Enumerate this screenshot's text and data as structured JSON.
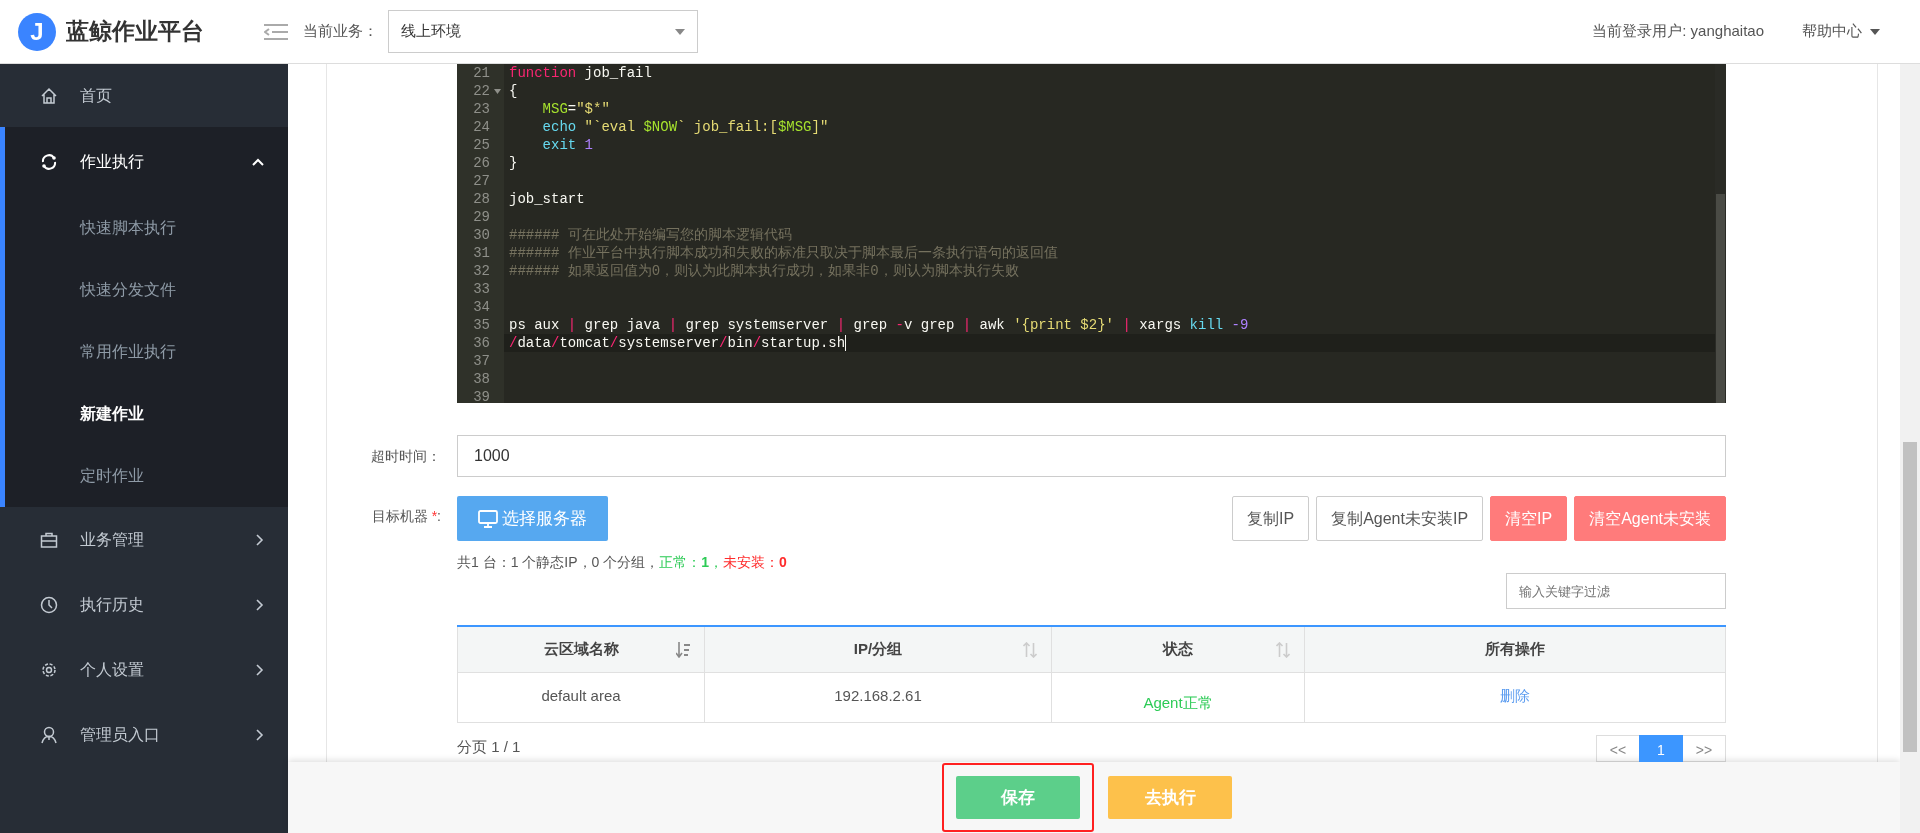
{
  "header": {
    "logo_mark": "J",
    "app_title": "蓝鲸作业平台",
    "business_label": "当前业务：",
    "business_value": "线上环境",
    "user_label": "当前登录用户: yanghaitao",
    "help_menu": "帮助中心"
  },
  "sidebar": {
    "items": [
      {
        "label": "首页",
        "kind": "link",
        "selected": false
      },
      {
        "label": "作业执行",
        "kind": "menu",
        "expanded": true,
        "selected": false,
        "children": [
          {
            "label": "快速脚本执行",
            "selected": false
          },
          {
            "label": "快速分发文件",
            "selected": false
          },
          {
            "label": "常用作业执行",
            "selected": false
          },
          {
            "label": "新建作业",
            "selected": true
          },
          {
            "label": "定时作业",
            "selected": false
          }
        ]
      },
      {
        "label": "业务管理",
        "kind": "menu",
        "expanded": false,
        "selected": false
      },
      {
        "label": "执行历史",
        "kind": "menu",
        "expanded": false,
        "selected": false
      },
      {
        "label": "个人设置",
        "kind": "menu",
        "expanded": false,
        "selected": false
      },
      {
        "label": "管理员入口",
        "kind": "menu",
        "expanded": false,
        "selected": false
      }
    ]
  },
  "editor": {
    "lines": [
      {
        "number": "21",
        "tokens": [
          {
            "kind": "keyword",
            "text": "function"
          },
          {
            "kind": "plain",
            "text": " job_fail"
          }
        ]
      },
      {
        "number": "22",
        "fold": true,
        "tokens": [
          {
            "kind": "plain",
            "text": "{"
          }
        ]
      },
      {
        "number": "23",
        "tokens": [
          {
            "kind": "variable",
            "text": "    MSG"
          },
          {
            "kind": "plain",
            "text": "="
          },
          {
            "kind": "string",
            "text": "\"$*\""
          }
        ]
      },
      {
        "number": "24",
        "tokens": [
          {
            "kind": "builtin",
            "text": "    echo"
          },
          {
            "kind": "string",
            "text": " \"`eval "
          },
          {
            "kind": "variable",
            "text": "$NOW"
          },
          {
            "kind": "string",
            "text": "` job_fail:["
          },
          {
            "kind": "variable",
            "text": "$MSG"
          },
          {
            "kind": "string",
            "text": "]\""
          }
        ]
      },
      {
        "number": "25",
        "tokens": [
          {
            "kind": "builtin",
            "text": "    exit"
          },
          {
            "kind": "number",
            "text": " 1"
          }
        ]
      },
      {
        "number": "26",
        "tokens": [
          {
            "kind": "plain",
            "text": "}"
          }
        ]
      },
      {
        "number": "27"
      },
      {
        "number": "28",
        "tokens": [
          {
            "kind": "plain",
            "text": "job_start"
          }
        ]
      },
      {
        "number": "29"
      },
      {
        "number": "30",
        "tokens": [
          {
            "kind": "comment",
            "text": "###### 可在此处开始编写您的脚本逻辑代码"
          }
        ]
      },
      {
        "number": "31",
        "tokens": [
          {
            "kind": "comment",
            "text": "###### 作业平台中执行脚本成功和失败的标准只取决于脚本最后一条执行语句的返回值"
          }
        ]
      },
      {
        "number": "32",
        "tokens": [
          {
            "kind": "comment",
            "text": "###### 如果返回值为0，则认为此脚本执行成功，如果非0，则认为脚本执行失败"
          }
        ]
      },
      {
        "number": "33"
      },
      {
        "number": "34"
      },
      {
        "number": "35",
        "tokens": [
          {
            "kind": "plain",
            "text": "ps aux "
          },
          {
            "kind": "operator",
            "text": "|"
          },
          {
            "kind": "plain",
            "text": " grep java "
          },
          {
            "kind": "operator",
            "text": "|"
          },
          {
            "kind": "plain",
            "text": " grep systemserver "
          },
          {
            "kind": "operator",
            "text": "|"
          },
          {
            "kind": "plain",
            "text": " grep "
          },
          {
            "kind": "operator",
            "text": "-"
          },
          {
            "kind": "plain",
            "text": "v grep "
          },
          {
            "kind": "operator",
            "text": "|"
          },
          {
            "kind": "plain",
            "text": " awk "
          },
          {
            "kind": "string",
            "text": "'{print $2}' "
          },
          {
            "kind": "operator",
            "text": "|"
          },
          {
            "kind": "plain",
            "text": " xargs "
          },
          {
            "kind": "builtin",
            "text": "kill"
          },
          {
            "kind": "number",
            "text": " -9"
          }
        ]
      },
      {
        "number": "36",
        "active": true,
        "tokens": [
          {
            "kind": "operator",
            "text": "/"
          },
          {
            "kind": "plain",
            "text": "data"
          },
          {
            "kind": "operator",
            "text": "/"
          },
          {
            "kind": "plain",
            "text": "tomcat"
          },
          {
            "kind": "operator",
            "text": "/"
          },
          {
            "kind": "plain",
            "text": "systemserver"
          },
          {
            "kind": "operator",
            "text": "/"
          },
          {
            "kind": "plain",
            "text": "bin"
          },
          {
            "kind": "operator",
            "text": "/"
          },
          {
            "kind": "plain",
            "text": "startup.sh"
          }
        ]
      },
      {
        "number": "37"
      },
      {
        "number": "38"
      },
      {
        "number": "39"
      }
    ]
  },
  "form": {
    "timeout": {
      "label": "超时时间：",
      "value": "1000"
    },
    "target": {
      "label": "目标机器 ",
      "required_mark": "*",
      "label_end": ":",
      "select_button": "选择服务器",
      "actions": [
        {
          "label": "复制IP",
          "kind": "default"
        },
        {
          "label": "复制Agent未安装IP",
          "kind": "default"
        },
        {
          "label": "清空IP",
          "kind": "danger"
        },
        {
          "label": "清空Agent未安装",
          "kind": "danger"
        }
      ],
      "summary": [
        {
          "kind": "plain",
          "text": "共1 台：1 个静态IP，0 个分组，"
        },
        {
          "kind": "ok",
          "text": "正常：**1**，"
        },
        {
          "kind": "bad",
          "text": "未安装：**0**"
        }
      ],
      "filter": {
        "placeholder": "输入关键字过滤"
      }
    }
  },
  "table": {
    "columns": [
      {
        "label": "云区域名称",
        "sortable": true,
        "sorted": true
      },
      {
        "label": "IP/分组",
        "sortable": true,
        "sorted": false
      },
      {
        "label": "状态",
        "sortable": true,
        "sorted": false
      },
      {
        "label": "所有操作",
        "sortable": false
      }
    ],
    "rows": [
      {
        "cells": [
          "default area",
          "192.168.2.61"
        ],
        "status": "Agent正常",
        "healthy": true,
        "action": "删除"
      }
    ]
  },
  "pagination": {
    "info": "分页 1 / 1",
    "pages": [
      {
        "label": "<<",
        "selected": false
      },
      {
        "label": "1",
        "selected": true
      },
      {
        "label": ">>",
        "selected": false
      }
    ]
  },
  "footer": {
    "buttons": [
      {
        "label": "保存",
        "kind": "save",
        "highlighted": true
      },
      {
        "label": "去执行",
        "kind": "run",
        "highlighted": false
      }
    ]
  }
}
